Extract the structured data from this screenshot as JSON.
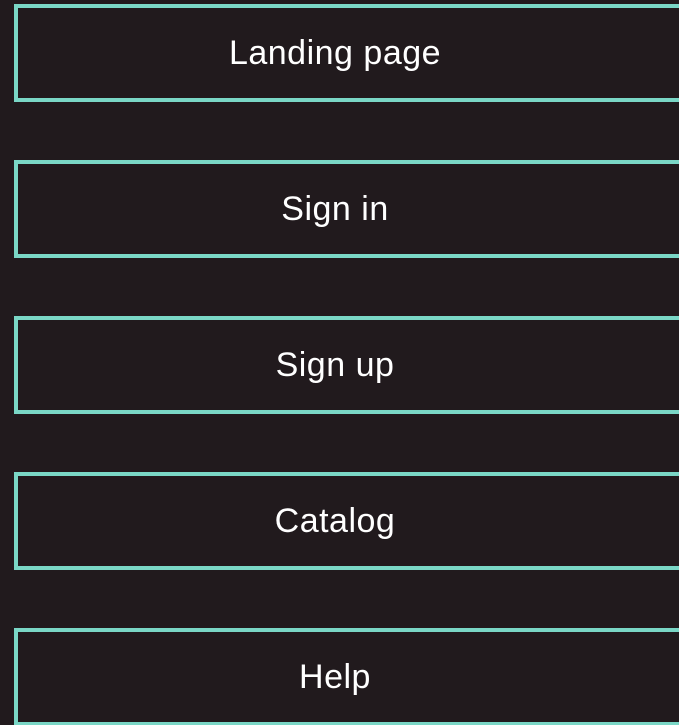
{
  "theme": {
    "background": "#211A1D",
    "accent_border": "#7AD7C6",
    "text": "#FFFFFF"
  },
  "menu": {
    "items": [
      {
        "label": "Landing page"
      },
      {
        "label": "Sign in"
      },
      {
        "label": "Sign up"
      },
      {
        "label": "Catalog"
      },
      {
        "label": "Help"
      }
    ]
  }
}
